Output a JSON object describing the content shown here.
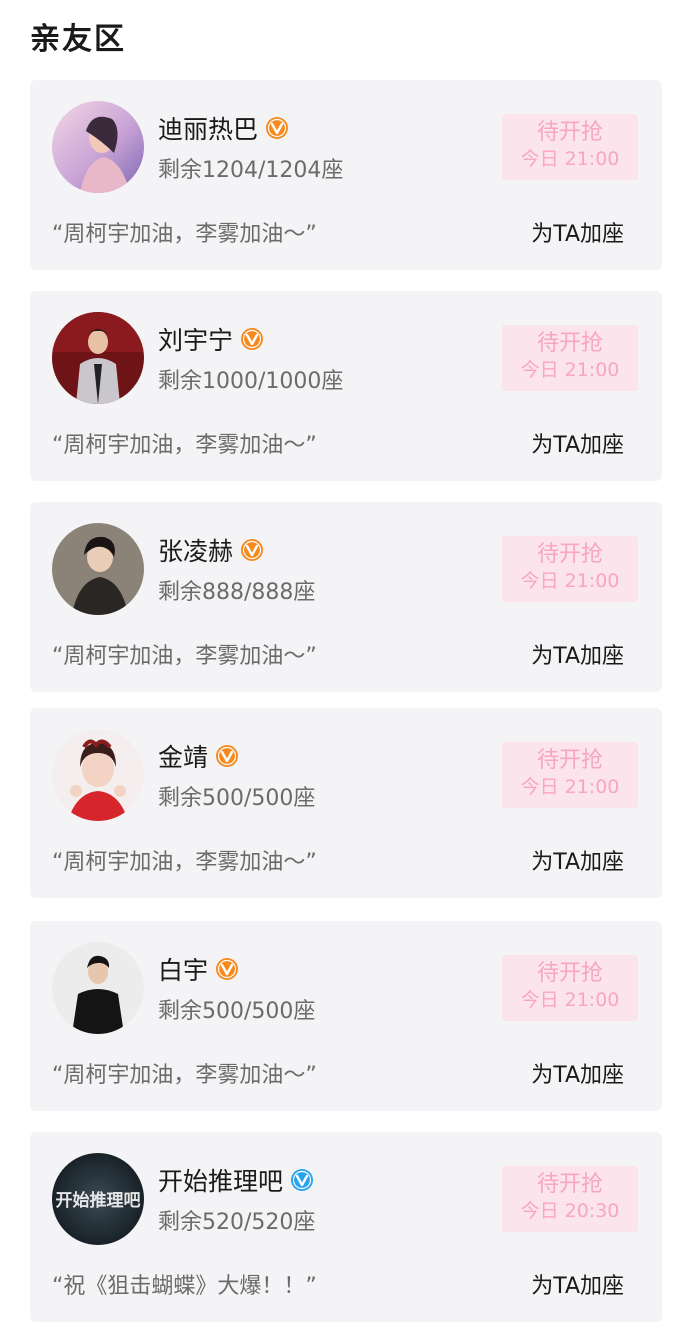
{
  "section_title": "亲友区",
  "add_seat_label": "为TA加座",
  "cards": [
    {
      "name": "迪丽热巴",
      "verified": "orange-v-badge-icon",
      "seats": "剩余1204/1204座",
      "message": "“周柯宇加油，李雾加油～”",
      "status": "待开抢",
      "time": "今日 21:00"
    },
    {
      "name": "刘宇宁",
      "verified": "orange-v-badge-icon",
      "seats": "剩余1000/1000座",
      "message": "“周柯宇加油，李雾加油～”",
      "status": "待开抢",
      "time": "今日 21:00"
    },
    {
      "name": "张凌赫",
      "verified": "orange-v-badge-icon",
      "seats": "剩余888/888座",
      "message": "“周柯宇加油，李雾加油～”",
      "status": "待开抢",
      "time": "今日 21:00"
    },
    {
      "name": "金靖",
      "verified": "orange-v-badge-icon",
      "seats": "剩余500/500座",
      "message": "“周柯宇加油，李雾加油～”",
      "status": "待开抢",
      "time": "今日 21:00"
    },
    {
      "name": "白宇",
      "verified": "orange-v-badge-icon",
      "seats": "剩余500/500座",
      "message": "“周柯宇加油，李雾加油～”",
      "status": "待开抢",
      "time": "今日 21:00"
    },
    {
      "name": "开始推理吧",
      "verified": "blue-v-badge-icon",
      "seats": "剩余520/520座",
      "message": "“祝《狙击蝴蝶》大爆！！”",
      "status": "待开抢",
      "time": "今日 20:30",
      "avatar_text": "开始推理吧"
    }
  ],
  "colors": {
    "card_bg": "#f4f4f6",
    "pending_bg": "#fce4ec",
    "pending_text": "#f7a6c0",
    "orange_badge": "#f58a1f",
    "blue_badge": "#2aa3ef"
  }
}
